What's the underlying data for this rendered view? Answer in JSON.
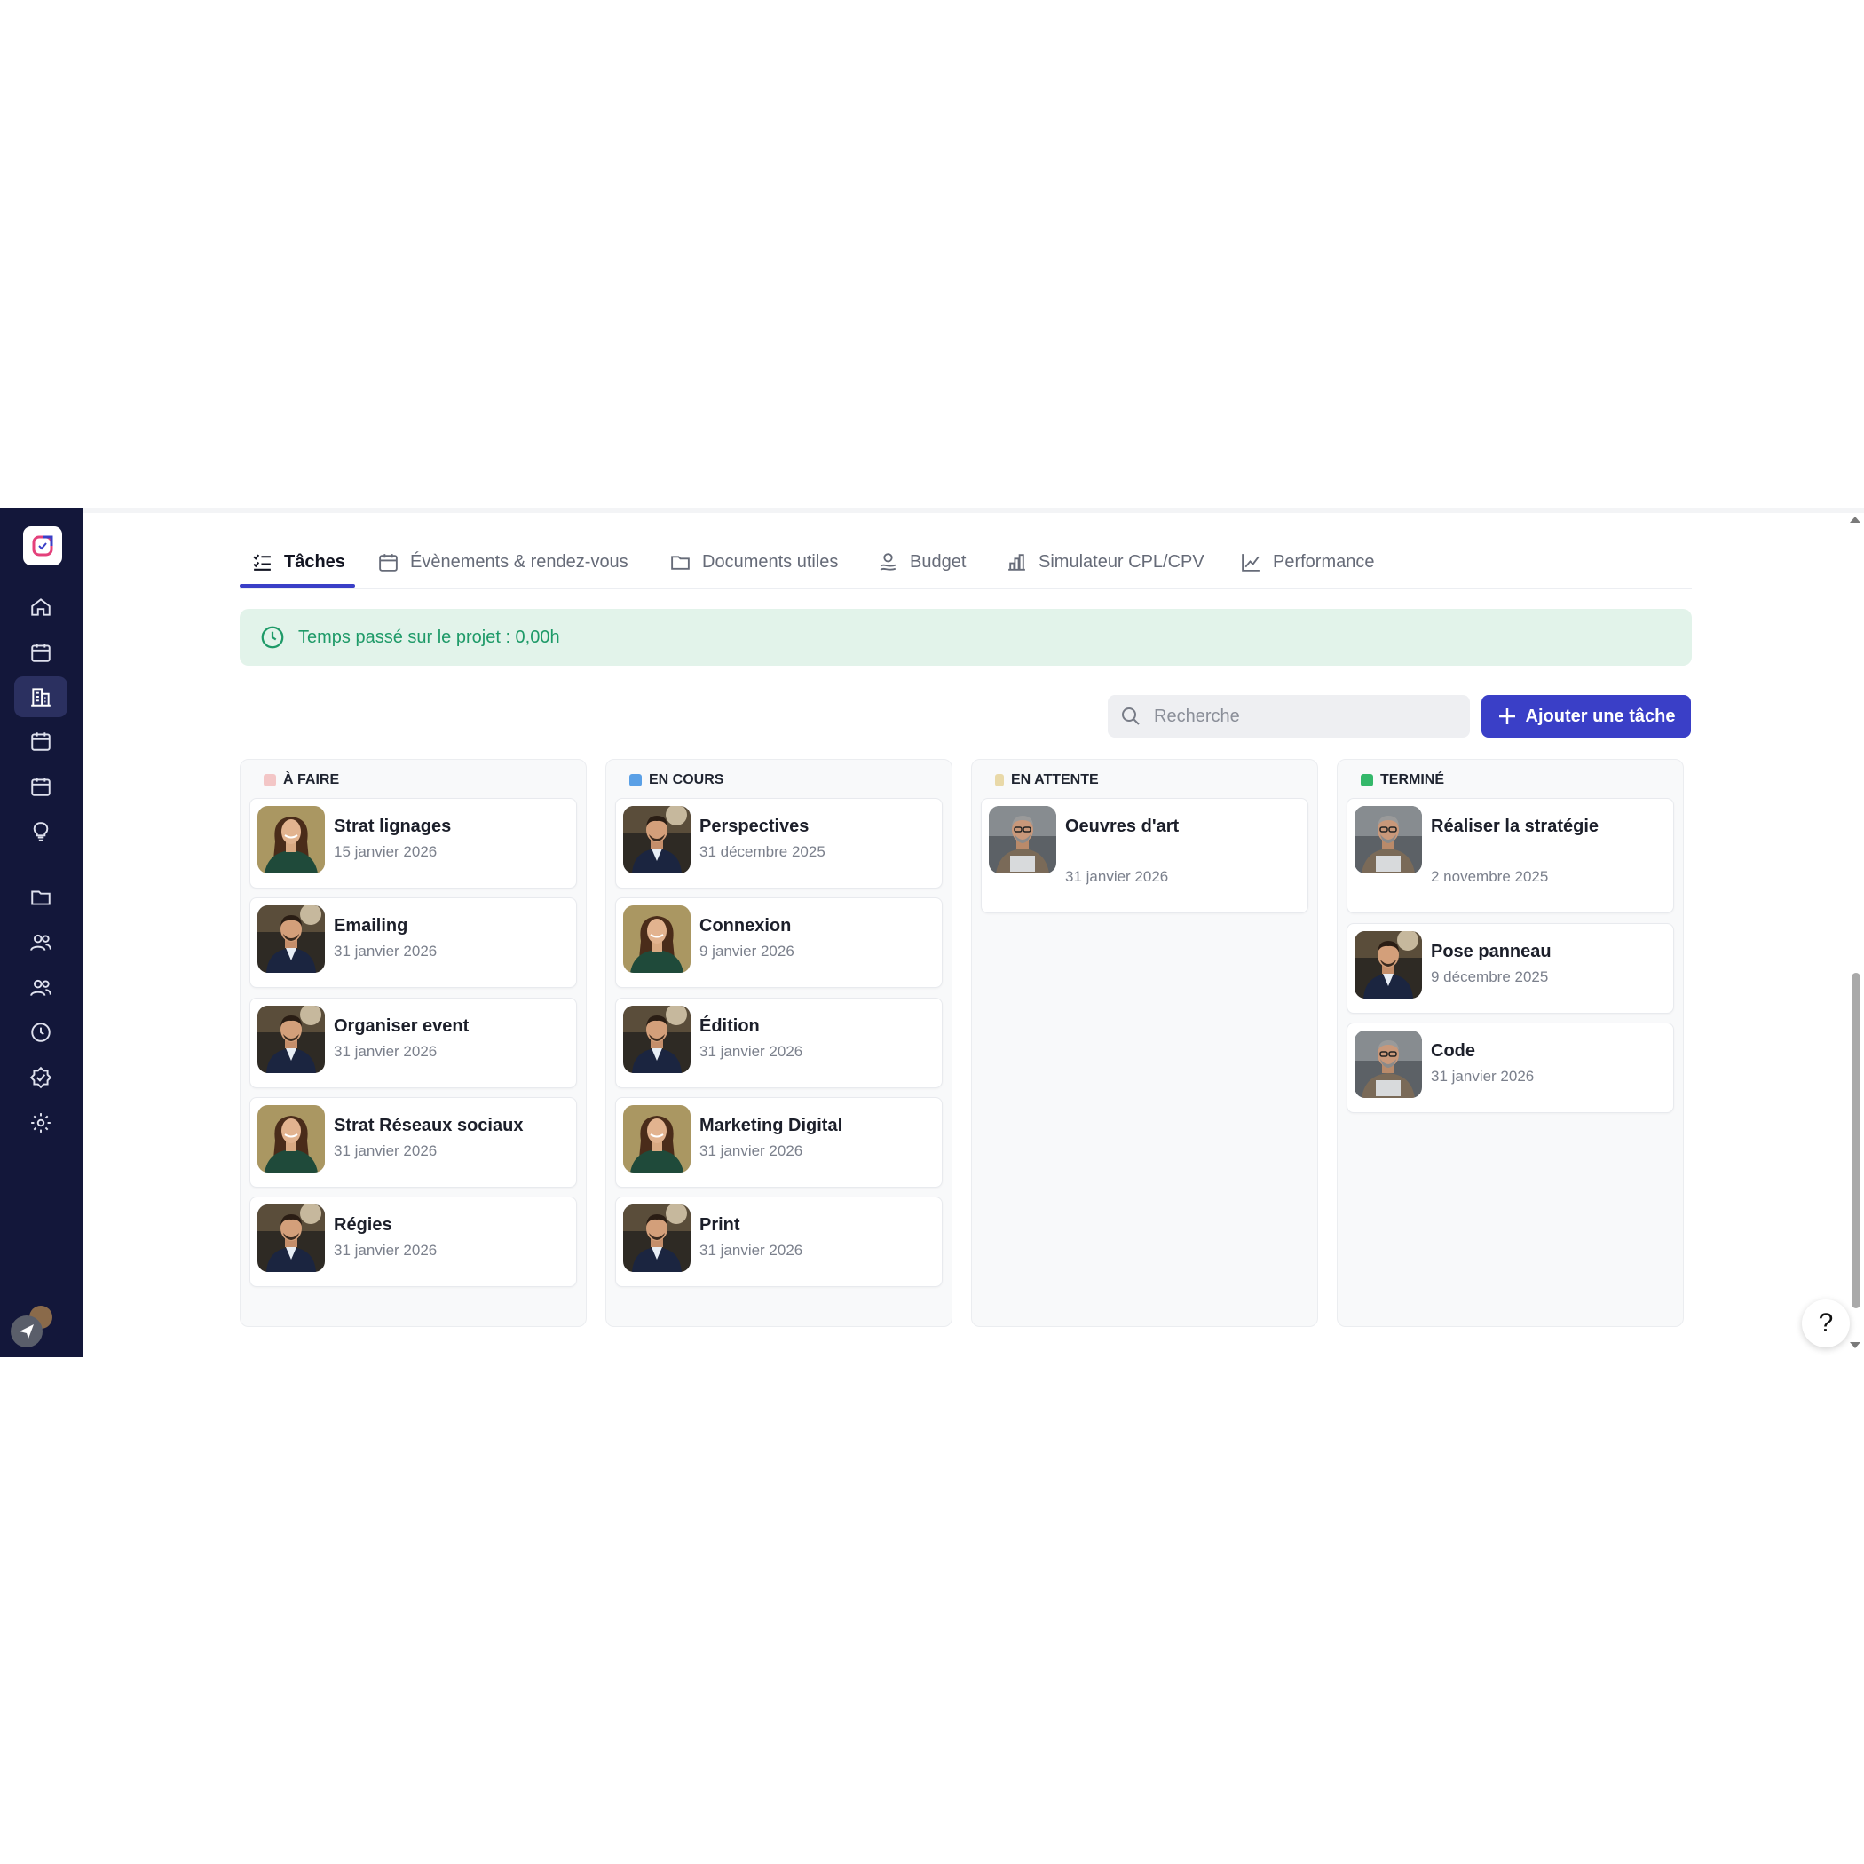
{
  "tabs": [
    {
      "label": "Tâches",
      "icon": "checklist-icon",
      "active": true
    },
    {
      "label": "Évènements & rendez-vous",
      "icon": "calendar-icon"
    },
    {
      "label": "Documents utiles",
      "icon": "folder-icon"
    },
    {
      "label": "Budget",
      "icon": "coins-icon"
    },
    {
      "label": "Simulateur CPL/CPV",
      "icon": "bar-chart-icon"
    },
    {
      "label": "Performance",
      "icon": "line-chart-icon"
    }
  ],
  "banner": {
    "text": "Temps passé sur le projet : 0,00h",
    "icon": "clock-icon"
  },
  "search": {
    "placeholder": "Recherche"
  },
  "add_button": {
    "label": "Ajouter une tâche"
  },
  "colors": {
    "accent": "#3a3fc7",
    "sidebar": "#13173a",
    "banner_bg": "#e2f3ea",
    "banner_text": "#1e9a68"
  },
  "columns": [
    {
      "title": "À FAIRE",
      "icon": "pin-icon",
      "cards": [
        {
          "title": "Strat lignages",
          "date": "15 janvier 2026",
          "avatar": "woman"
        },
        {
          "title": "Emailing",
          "date": "31 janvier 2026",
          "avatar": "man"
        },
        {
          "title": "Organiser event",
          "date": "31 janvier 2026",
          "avatar": "man"
        },
        {
          "title": "Strat Réseaux sociaux",
          "date": "31 janvier 2026",
          "avatar": "woman"
        },
        {
          "title": "Régies",
          "date": "31 janvier 2026",
          "avatar": "man"
        }
      ]
    },
    {
      "title": "EN COURS",
      "icon": "refresh-icon",
      "cards": [
        {
          "title": "Perspectives",
          "date": "31 décembre 2025",
          "avatar": "man"
        },
        {
          "title": "Connexion",
          "date": "9 janvier 2026",
          "avatar": "woman"
        },
        {
          "title": "Édition",
          "date": "31 janvier 2026",
          "avatar": "man"
        },
        {
          "title": "Marketing Digital",
          "date": "31 janvier 2026",
          "avatar": "woman"
        },
        {
          "title": "Print",
          "date": "31 janvier 2026",
          "avatar": "man"
        }
      ]
    },
    {
      "title": "EN ATTENTE",
      "icon": "hourglass-icon",
      "cards": [
        {
          "title": "Oeuvres d'art",
          "date": "31 janvier 2026",
          "avatar": "older-man"
        }
      ]
    },
    {
      "title": "TERMINÉ",
      "icon": "check-box-icon",
      "cards": [
        {
          "title": "Réaliser la stratégie",
          "date": "2 novembre 2025",
          "avatar": "older-man"
        },
        {
          "title": "Pose panneau",
          "date": "9 décembre 2025",
          "avatar": "man"
        },
        {
          "title": "Code",
          "date": "31 janvier 2026",
          "avatar": "older-man"
        }
      ]
    }
  ],
  "help": {
    "label": "?"
  }
}
